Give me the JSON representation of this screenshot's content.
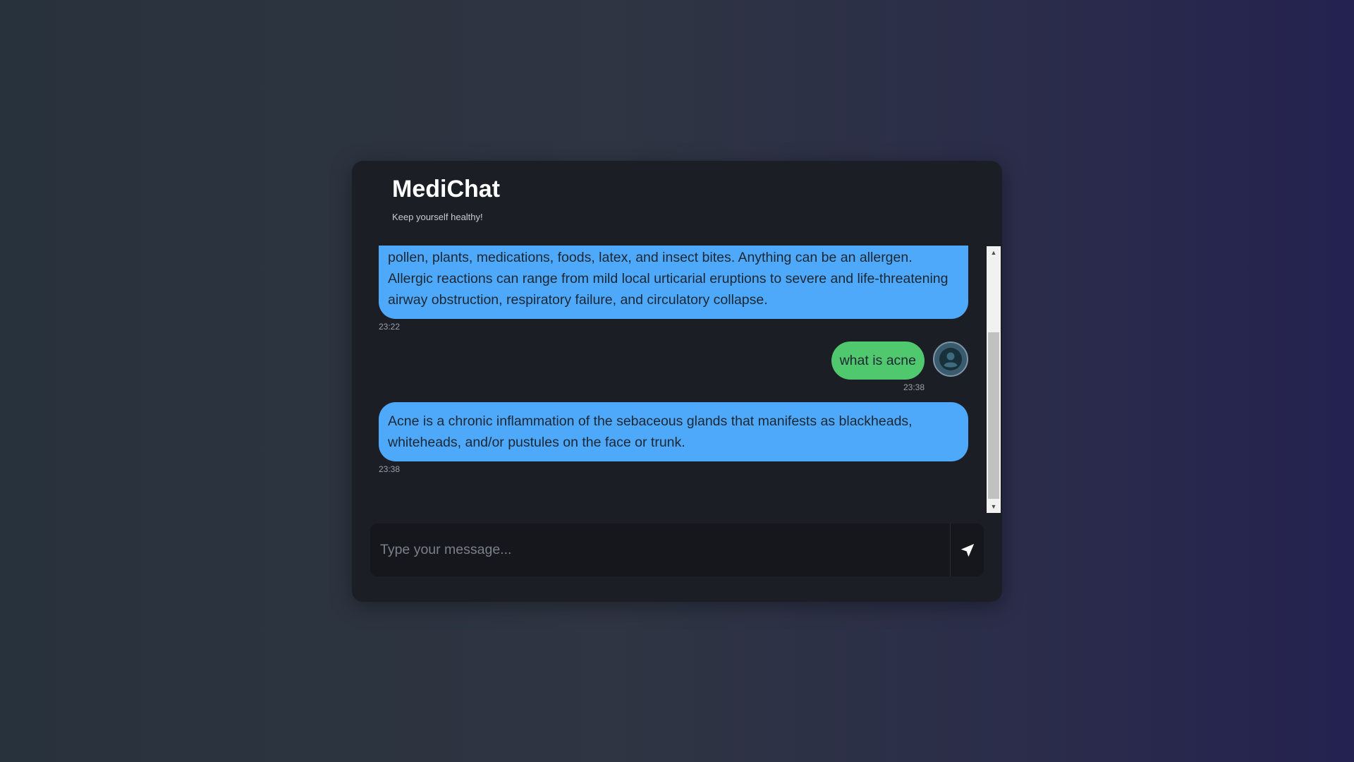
{
  "header": {
    "title": "MediChat",
    "subtitle": "Keep yourself healthy!"
  },
  "messages": [
    {
      "sender": "bot",
      "text": "skin, nose, eyes, respiratory tract or gastrointestinal tract. Examples of allergens are dust, pollen, plants, medications, foods, latex, and insect bites. Anything can be an allergen. Allergic reactions can range from mild local urticarial eruptions to severe and life-threatening airway obstruction, respiratory failure, and circulatory collapse.",
      "time": "23:22"
    },
    {
      "sender": "user",
      "text": "what is acne",
      "time": "23:38",
      "avatar_icon": "user-avatar-icon"
    },
    {
      "sender": "bot",
      "text": "Acne is a chronic inflammation of the sebaceous glands that manifests as blackheads, whiteheads, and/or pustules on the face or trunk.",
      "time": "23:38"
    }
  ],
  "composer": {
    "placeholder": "Type your message...",
    "value": "",
    "send_icon": "send-icon"
  },
  "colors": {
    "bot_bubble": "#4ea9fb",
    "user_bubble": "#50c86e",
    "card_background": "#1c1e25"
  }
}
